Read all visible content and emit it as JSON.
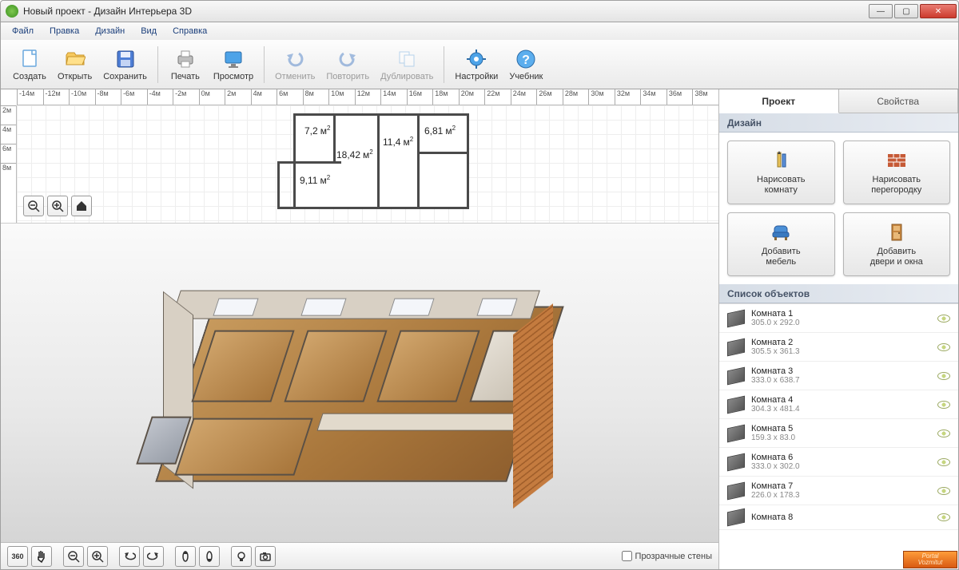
{
  "window": {
    "title": "Новый проект - Дизайн Интерьера 3D"
  },
  "menu": {
    "file": "Файл",
    "edit": "Правка",
    "design": "Дизайн",
    "view": "Вид",
    "help": "Справка"
  },
  "toolbar": {
    "create": "Создать",
    "open": "Открыть",
    "save": "Сохранить",
    "print": "Печать",
    "preview": "Просмотр",
    "undo": "Отменить",
    "redo": "Повторить",
    "duplicate": "Дублировать",
    "settings": "Настройки",
    "tutorial": "Учебник"
  },
  "ruler_h": [
    "-14м",
    "-12м",
    "-10м",
    "-8м",
    "-6м",
    "-4м",
    "-2м",
    "0м",
    "2м",
    "4м",
    "6м",
    "8м",
    "10м",
    "12м",
    "14м",
    "16м",
    "18м",
    "20м",
    "22м",
    "24м",
    "26м",
    "28м",
    "30м",
    "32м",
    "34м",
    "36м",
    "38м"
  ],
  "ruler_v": [
    "2м",
    "4м",
    "6м",
    "8м"
  ],
  "floorplan": {
    "room1": "7,2",
    "room2": "18,42",
    "room3": "11,4",
    "room4": "6,81",
    "room5": "9,11",
    "unit": "м"
  },
  "bottom": {
    "transparent_walls": "Прозрачные стены"
  },
  "sidebar": {
    "tabs": {
      "project": "Проект",
      "properties": "Свойства"
    },
    "design_head": "Дизайн",
    "buttons": {
      "draw_room": "Нарисовать\nкомнату",
      "draw_partition": "Нарисовать\nперегородку",
      "add_furniture": "Добавить\nмебель",
      "add_doors": "Добавить\nдвери и окна"
    },
    "objects_head": "Список объектов",
    "objects": [
      {
        "name": "Комната 1",
        "dim": "305.0 x 292.0"
      },
      {
        "name": "Комната 2",
        "dim": "305.5 x 361.3"
      },
      {
        "name": "Комната 3",
        "dim": "333.0 x 638.7"
      },
      {
        "name": "Комната 4",
        "dim": "304.3 x 481.4"
      },
      {
        "name": "Комната 5",
        "dim": "159.3 x 83.0"
      },
      {
        "name": "Комната 6",
        "dim": "333.0 x 302.0"
      },
      {
        "name": "Комната 7",
        "dim": "226.0 x 178.3"
      },
      {
        "name": "Комната 8",
        "dim": ""
      }
    ]
  },
  "watermark": {
    "line1": "Portal",
    "line2": "Vozmitut"
  }
}
